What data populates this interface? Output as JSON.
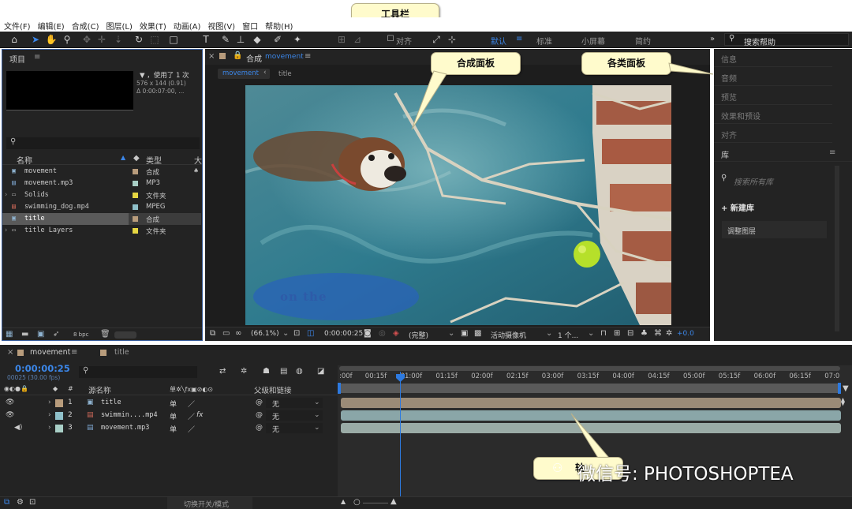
{
  "menu": [
    "文件(F)",
    "编辑(E)",
    "合成(C)",
    "图层(L)",
    "效果(T)",
    "动画(A)",
    "视图(V)",
    "窗口",
    "帮助(H)"
  ],
  "callouts": {
    "toolbar": "工具栏",
    "comp_panel": "合成面板",
    "panels": "各类面板",
    "timeline_partial": "轴"
  },
  "toolbar": {
    "align": "对齐",
    "workspaces": [
      "默认",
      "标准",
      "小屏幕",
      "简约"
    ],
    "search_placeholder": "搜索帮助"
  },
  "project": {
    "title": "项目",
    "info_lines": [
      "▼ ，使用了 1 次",
      "576 x 144 (0.91)",
      "Δ 0:00:07:00, ..."
    ],
    "col_name": "名称",
    "col_type": "类型",
    "col_size": "大",
    "items": [
      {
        "name": "movement",
        "type": "合成",
        "color": "#b89c7c",
        "icon": "comp-icon"
      },
      {
        "name": "movement.mp3",
        "type": "MP3",
        "color": "#a9cfc6",
        "icon": "audio-icon"
      },
      {
        "name": "Solids",
        "type": "文件夹",
        "color": "#e6d642",
        "icon": "folder-icon"
      },
      {
        "name": "swimming_dog.mp4",
        "type": "MPEG",
        "color": "#8fc0c9",
        "icon": "video-icon"
      },
      {
        "name": "title",
        "type": "合成",
        "color": "#b89c7c",
        "icon": "comp-icon"
      },
      {
        "name": "title Layers",
        "type": "文件夹",
        "color": "#e6d642",
        "icon": "folder-icon"
      }
    ],
    "bpc": "8 bpc"
  },
  "comp": {
    "title": "合成",
    "comp_name": "movement",
    "breadcrumbs": [
      "movement",
      "title"
    ],
    "overlay_text": "on the",
    "zoom": "(66.1%)",
    "timecode": "0:00:00:25",
    "quality": "(完整)",
    "camera": "活动摄像机",
    "views": "1 个...",
    "exposure": "+0.0"
  },
  "right": {
    "items": [
      "信息",
      "音频",
      "预览",
      "效果和预设",
      "对齐"
    ],
    "library_title": "库",
    "library_search": "搜索所有库",
    "new_library": "+ 新建库",
    "library_item": "调整图层"
  },
  "timeline": {
    "tabs": [
      "movement",
      "title"
    ],
    "timecode": "0:00:00:25",
    "fps": "00025 (30.00 fps)",
    "col_source": "源名称",
    "col_parent": "父级和链接",
    "col_switch_icons": "单✲╲fx▣⊘◐⊙",
    "layers": [
      {
        "num": "1",
        "name": "title",
        "color": "#b89c7c",
        "parent": "无",
        "fx": ""
      },
      {
        "num": "2",
        "name": "swimmin....mp4",
        "color": "#8fc0c9",
        "parent": "无",
        "fx": "fx"
      },
      {
        "num": "3",
        "name": "movement.mp3",
        "color": "#a9cfc6",
        "parent": "无",
        "fx": ""
      }
    ],
    "ruler": [
      ":00f",
      "00:15f",
      "01:00f",
      "01:15f",
      "02:00f",
      "02:15f",
      "03:00f",
      "03:15f",
      "04:00f",
      "04:15f",
      "05:00f",
      "05:15f",
      "06:00f",
      "06:15f",
      "07:0"
    ],
    "switch_mode": "切换开关/模式",
    "watermark": "微信号: PHOTOSHOPTEA"
  }
}
